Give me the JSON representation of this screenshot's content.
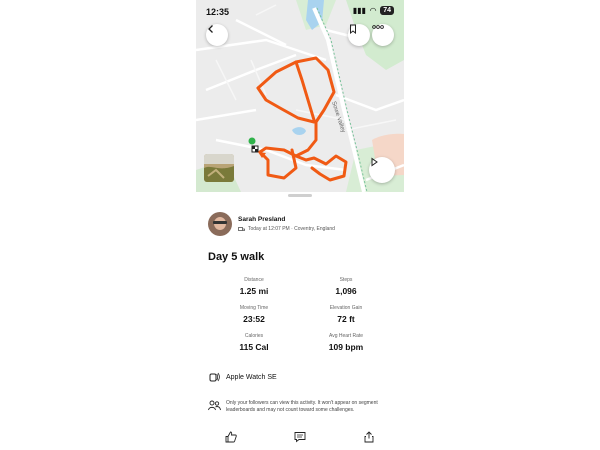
{
  "status_bar": {
    "time": "12:35",
    "battery": "74"
  },
  "map": {
    "road_label": "Sowe Valley",
    "route_color": "#f05a14"
  },
  "athlete": {
    "name": "Sarah Presland",
    "meta": "Today at 12:07 PM · Coventry, England"
  },
  "activity": {
    "title": "Day 5 walk"
  },
  "stats": [
    {
      "label": "Distance",
      "value": "1.25 mi"
    },
    {
      "label": "Steps",
      "value": "1,096"
    },
    {
      "label": "Moving Time",
      "value": "23:52"
    },
    {
      "label": "Elevation Gain",
      "value": "72 ft"
    },
    {
      "label": "Calories",
      "value": "115 Cal"
    },
    {
      "label": "Avg Heart Rate",
      "value": "109 bpm"
    }
  ],
  "device": {
    "name": "Apple Watch SE"
  },
  "privacy": {
    "text": "Only your followers can view this activity. It won't appear on segment leaderboards and may not count toward some challenges."
  },
  "icons": {
    "back": "chevron-left-icon",
    "bookmark": "bookmark-icon",
    "more": "more-icon",
    "play": "play-icon",
    "kudos": "thumbs-up-icon",
    "comment": "comment-icon",
    "share": "share-icon"
  }
}
